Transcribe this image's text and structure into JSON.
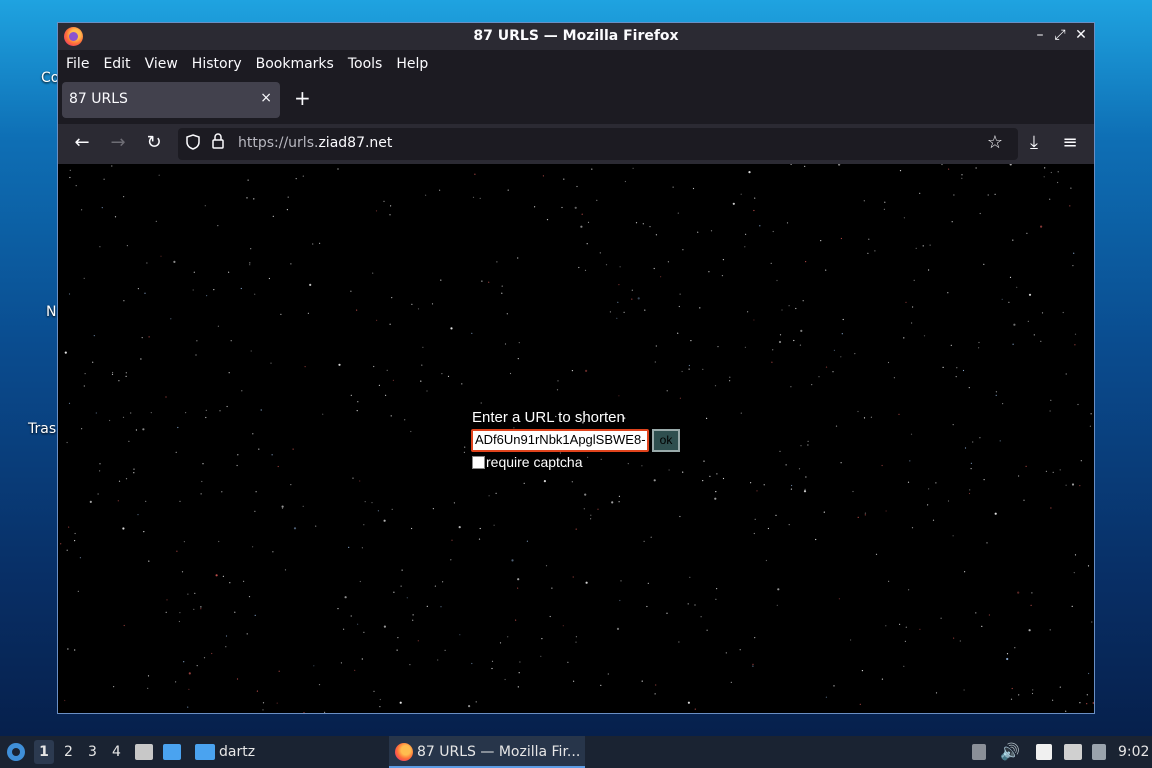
{
  "desktop": {
    "labels": [
      "Co",
      "N",
      "Tras"
    ]
  },
  "window": {
    "title": "87 URLS — Mozilla Firefox",
    "controls": {
      "minimize": "–",
      "restore": "⤢",
      "close": "✕"
    }
  },
  "menubar": {
    "items": [
      "File",
      "Edit",
      "View",
      "History",
      "Bookmarks",
      "Tools",
      "Help"
    ]
  },
  "tabs": [
    {
      "label": "87 URLS",
      "close": "×"
    }
  ],
  "newtab": "+",
  "navbar": {
    "back": "←",
    "forward": "→",
    "reload": "↻",
    "url_prefix": "https://urls.",
    "url_domain": "ziad87.net",
    "bookmark_icon": "☆",
    "download_icon": "⤓",
    "menu_icon": "≡"
  },
  "page": {
    "heading": "Enter a URL to shorten",
    "url_value": "ADf6Un91rNbk1ApglSBWE8-",
    "ok_label": "ok",
    "captcha_label": "require captcha",
    "captcha_checked": false
  },
  "taskbar": {
    "workspaces": [
      "1",
      "2",
      "3",
      "4"
    ],
    "folder_label": "dartz",
    "active_app": "87 URLS — Mozilla Fir...",
    "clock": "9:02"
  }
}
